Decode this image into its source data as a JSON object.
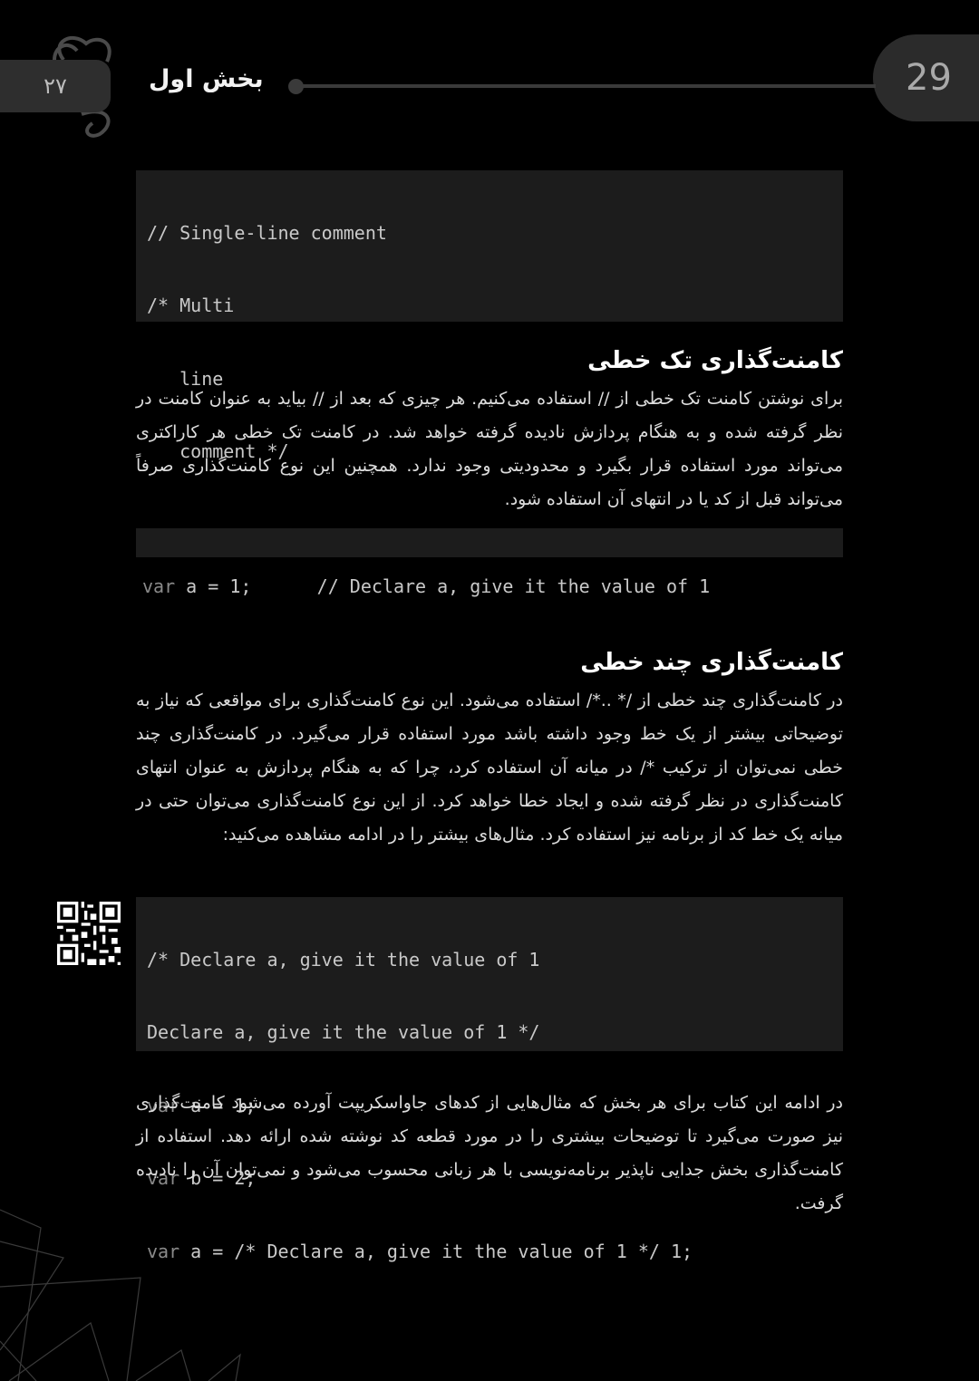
{
  "header": {
    "page_number_latin": "29",
    "page_number_persian": "۲۷",
    "chapter_title": "بخش اول"
  },
  "code1": {
    "lines": [
      "// Single-line comment",
      "/* Multi",
      "   line",
      "   comment */"
    ]
  },
  "section1": {
    "heading": "کامنت‌گذاری تک خطی",
    "paragraph": "برای نوشتن کامنت تک خطی از // استفاده می‌کنیم. هر چیزی که بعد از // بیاید به عنوان کامنت در نظر گرفته شده و به هنگام پردازش نادیده گرفته خواهد شد. در کامنت تک خطی هر کاراکتری می‌تواند مورد استفاده قرار بگیرد و محدودیتی وجود ندارد. همچنین این نوع کامنت‌گذاری صرفاً می‌تواند قبل از کد یا در انتهای آن استفاده شود."
  },
  "code2": {
    "keyword": "var",
    "rest": " a = 1;      // Declare a, give it the value of 1"
  },
  "section2": {
    "heading": "کامنت‌گذاری چند خطی",
    "paragraph": "در کامنت‌گذاری چند خطی از /* ..*/ استفاده می‌شود. این نوع کامنت‌گذاری برای مواقعی که نیاز به توضیحاتی بیشتر از یک خط وجود داشته باشد مورد استفاده قرار می‌گیرد. در کامنت‌گذاری چند خطی نمی‌توان از ترکیب */ در میانه آن استفاده کرد، چرا که به هنگام پردازش به عنوان انتهای کامنت‌گذاری در نظر گرفته شده و ایجاد خطا خواهد کرد. از این نوع کامنت‌گذاری می‌توان حتی در میانه یک خط کد از برنامه نیز استفاده کرد. مثال‌های بیشتر را در ادامه مشاهده می‌کنید:"
  },
  "code3": {
    "line1": "/* Declare a, give it the value of 1",
    "line2": "Declare a, give it the value of 1 */",
    "line3_kw": "var",
    "line3_rest": " a = 1;",
    "line4_kw": "var",
    "line4_rest": " b = 2;",
    "line5_kw": "var",
    "line5_rest": " a = /* Declare a, give it the value of 1 */ 1;"
  },
  "closing": {
    "paragraph": "در ادامه این کتاب برای هر بخش که مثال‌هایی از کدهای جاواسکریپت آورده می‌شود کامنت‌گذاری نیز صورت می‌گیرد تا توضیحات بیشتری را در مورد قطعه کد نوشته شده ارائه دهد. استفاده از کامنت‌گذاری بخش جدایی ناپذیر برنامه‌نویسی با هر زبانی محسوب می‌شود و نمی‌توان آن را نادیده گرفت."
  },
  "icons": {
    "swirl": "decorative-swirl-icon",
    "qr": "qr-code-icon"
  },
  "colors": {
    "background": "#000000",
    "code_background": "#1c1c1c",
    "header_tab": "#2b2b2b"
  }
}
